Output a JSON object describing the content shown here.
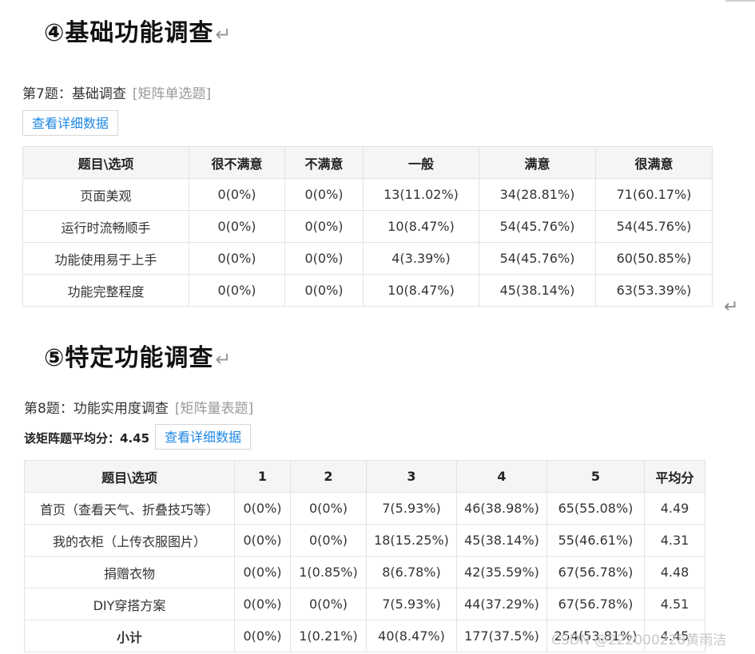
{
  "section4": {
    "heading": "④基础功能调查",
    "return_mark": "↵",
    "question_label": "第7题：基础调查",
    "question_type": "[矩阵单选题]",
    "detail_button": "查看详细数据",
    "table": {
      "headers": [
        "题目\\选项",
        "很不满意",
        "不满意",
        "一般",
        "满意",
        "很满意"
      ],
      "rows": [
        [
          "页面美观",
          "0(0%)",
          "0(0%)",
          "13(11.02%)",
          "34(28.81%)",
          "71(60.17%)"
        ],
        [
          "运行时流畅顺手",
          "0(0%)",
          "0(0%)",
          "10(8.47%)",
          "54(45.76%)",
          "54(45.76%)"
        ],
        [
          "功能使用易于上手",
          "0(0%)",
          "0(0%)",
          "4(3.39%)",
          "54(45.76%)",
          "60(50.85%)"
        ],
        [
          "功能完整程度",
          "0(0%)",
          "0(0%)",
          "10(8.47%)",
          "45(38.14%)",
          "63(53.39%)"
        ]
      ]
    }
  },
  "section5": {
    "heading": "⑤特定功能调查",
    "return_mark": "↵",
    "question_label": "第8题：功能实用度调查",
    "question_type": "[矩阵量表题]",
    "average_label": "该矩阵题平均分：4.45",
    "detail_button": "查看详细数据",
    "table": {
      "headers": [
        "题目\\选项",
        "1",
        "2",
        "3",
        "4",
        "5",
        "平均分"
      ],
      "rows": [
        [
          "首页（查看天气、折叠技巧等）",
          "0(0%)",
          "0(0%)",
          "7(5.93%)",
          "46(38.98%)",
          "65(55.08%)",
          "4.49"
        ],
        [
          "我的衣柜（上传衣服图片）",
          "0(0%)",
          "0(0%)",
          "18(15.25%)",
          "45(38.14%)",
          "55(46.61%)",
          "4.31"
        ],
        [
          "捐赠衣物",
          "0(0%)",
          "1(0.85%)",
          "8(6.78%)",
          "42(35.59%)",
          "67(56.78%)",
          "4.48"
        ],
        [
          "DIY穿搭方案",
          "0(0%)",
          "0(0%)",
          "7(5.93%)",
          "44(37.29%)",
          "67(56.78%)",
          "4.51"
        ],
        [
          "小计",
          "0(0%)",
          "1(0.21%)",
          "40(8.47%)",
          "177(37.5%)",
          "254(53.81%)",
          "4.45"
        ]
      ]
    }
  },
  "margin_return_mark": "↵",
  "watermark": "CSDN @222000228黄雨洁"
}
